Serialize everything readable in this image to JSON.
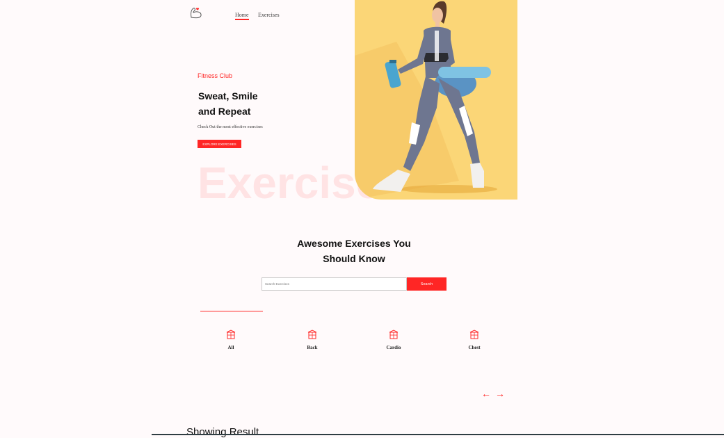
{
  "nav": {
    "logo_icon": "flexed-arm-icon",
    "links": [
      {
        "label": "Home",
        "active": true
      },
      {
        "label": "Exercises",
        "active": false
      }
    ]
  },
  "hero": {
    "tag": "Fitness Club",
    "title_line1": "Sweat, Smile",
    "title_line2": "and Repeat",
    "subtitle": "Check Out the most effective exercises",
    "button_label": "EXPLORE EXERCISES",
    "watermark": "Exercise",
    "image_background": "#fbd677"
  },
  "search": {
    "title_line1": "Awesome Exercises You",
    "title_line2": "Should Know",
    "placeholder": "Search Exercises",
    "button_label": "Search"
  },
  "categories": [
    {
      "label": "All",
      "icon": "gym-icon"
    },
    {
      "label": "Back",
      "icon": "gym-icon"
    },
    {
      "label": "Cardio",
      "icon": "gym-icon"
    },
    {
      "label": "Chest",
      "icon": "gym-icon"
    }
  ],
  "pager": {
    "prev": "←",
    "next": "→"
  },
  "results": {
    "title": "Showing Result"
  },
  "colors": {
    "accent": "#ff2625",
    "background": "#fffafb",
    "hero_image": "#fbd677"
  }
}
